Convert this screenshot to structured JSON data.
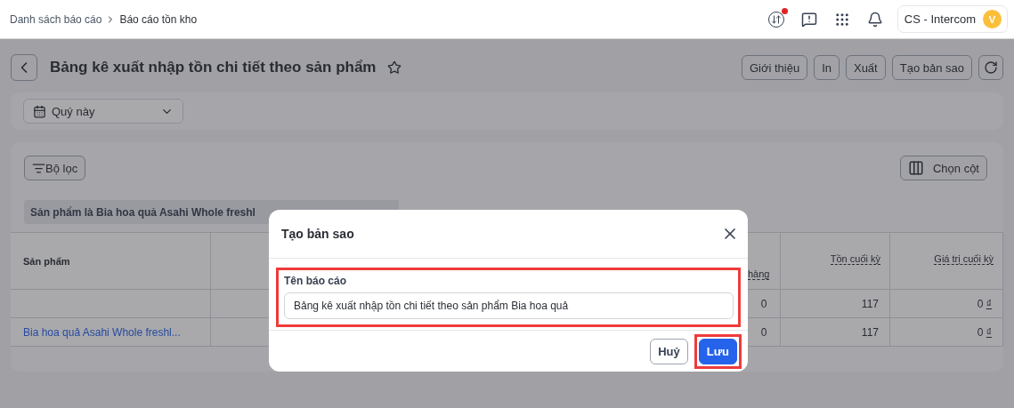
{
  "breadcrumb": [
    {
      "label": "Danh sách báo cáo"
    },
    {
      "label": "Báo cáo tồn kho"
    }
  ],
  "header": {
    "sync_alert": true,
    "account": {
      "name": "CS - Intercom",
      "avatar": "V"
    }
  },
  "page": {
    "title": "Bảng kê xuất nhập tồn chi tiết theo sản phẩm",
    "starred": false,
    "actions": [
      "Giới thiệu",
      "In",
      "Xuất",
      "Tạo bản sao"
    ]
  },
  "period": {
    "value": "Quý này"
  },
  "report": {
    "filter_button": "Bộ lọc",
    "columns_button": "Chọn cột",
    "filter_chip": "Sản phẩm là Bia hoa quả Asahi Whole freshl",
    "columns": [
      "Sản phẩm",
      "hàng",
      "Tồn cuối kỳ",
      "Giá trị cuối kỳ"
    ],
    "rows": [
      {
        "kind": "total",
        "product": "",
        "column_3": "0",
        "stock": "117",
        "value": "0",
        "currency": "₫"
      },
      {
        "kind": "product",
        "product": "Bia hoa quả Asahi Whole freshl...",
        "column_3": "0",
        "stock": "117",
        "value": "0",
        "currency": "₫"
      }
    ]
  },
  "dialog": {
    "title": "Tạo bản sao",
    "field_label": "Tên báo cáo",
    "field_value": "Bảng kê xuất nhập tồn chi tiết theo sản phẩm Bia hoa quả",
    "field_highlighted": true,
    "buttons": [
      {
        "label": "Huỷ",
        "primary": false,
        "highlighted": false
      },
      {
        "label": "Lưu",
        "primary": true,
        "highlighted": true
      }
    ]
  }
}
